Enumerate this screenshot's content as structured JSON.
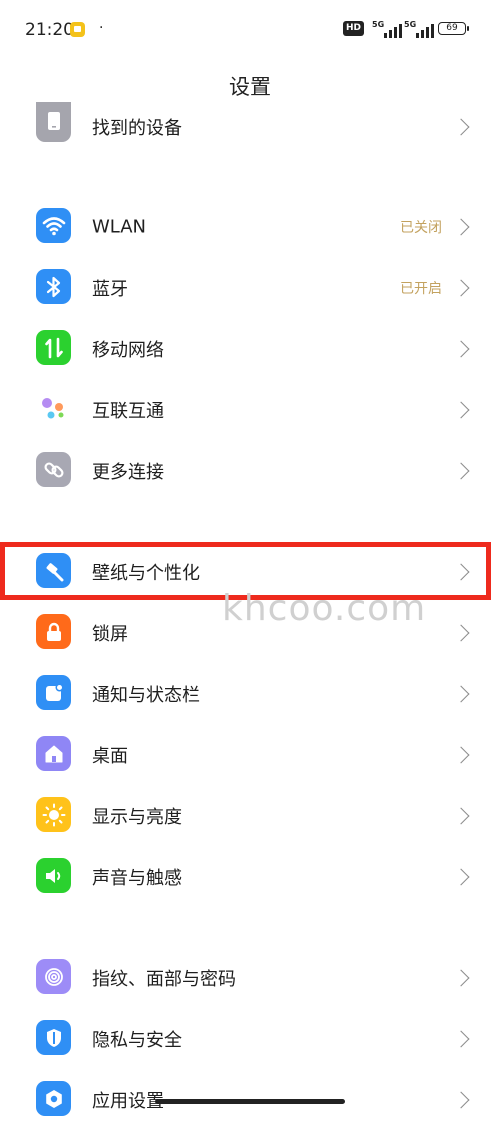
{
  "status_bar": {
    "time": "21:20",
    "dot": "·",
    "hd": "HD",
    "signal_1": "5G",
    "signal_2": "5G",
    "battery": "69"
  },
  "page_title": "设置",
  "settings": {
    "find_device": {
      "label": "找到的设备"
    },
    "wlan": {
      "label": "WLAN",
      "value": "已关闭"
    },
    "bluetooth": {
      "label": "蓝牙",
      "value": "已开启"
    },
    "mobile_network": {
      "label": "移动网络"
    },
    "interconnect": {
      "label": "互联互通"
    },
    "more_connections": {
      "label": "更多连接"
    },
    "wallpaper": {
      "label": "壁纸与个性化"
    },
    "lock_screen": {
      "label": "锁屏"
    },
    "notifications": {
      "label": "通知与状态栏"
    },
    "home_screen": {
      "label": "桌面"
    },
    "display": {
      "label": "显示与亮度"
    },
    "sound": {
      "label": "声音与触感"
    },
    "biometrics": {
      "label": "指纹、面部与密码"
    },
    "privacy": {
      "label": "隐私与安全"
    },
    "app_settings": {
      "label": "应用设置"
    }
  },
  "watermark": "khcoo.com",
  "icon_colors": {
    "wlan": "#2f8ff5",
    "bluetooth": "#2f8ff5",
    "mobile_network": "#2bd12f",
    "more_connections": "#a8a8b3",
    "wallpaper": "#2f8ff5",
    "lock_screen": "#ff6a1a",
    "notifications": "#2f8ff5",
    "home_screen": "#8f86f5",
    "display": "#ffc21a",
    "sound": "#2bd12f",
    "biometrics": "#9d8cf7",
    "privacy": "#2f8ff5",
    "app_settings": "#2f8ff5",
    "highlight": "#ee2a1d",
    "value_text": "#c3a25f"
  }
}
